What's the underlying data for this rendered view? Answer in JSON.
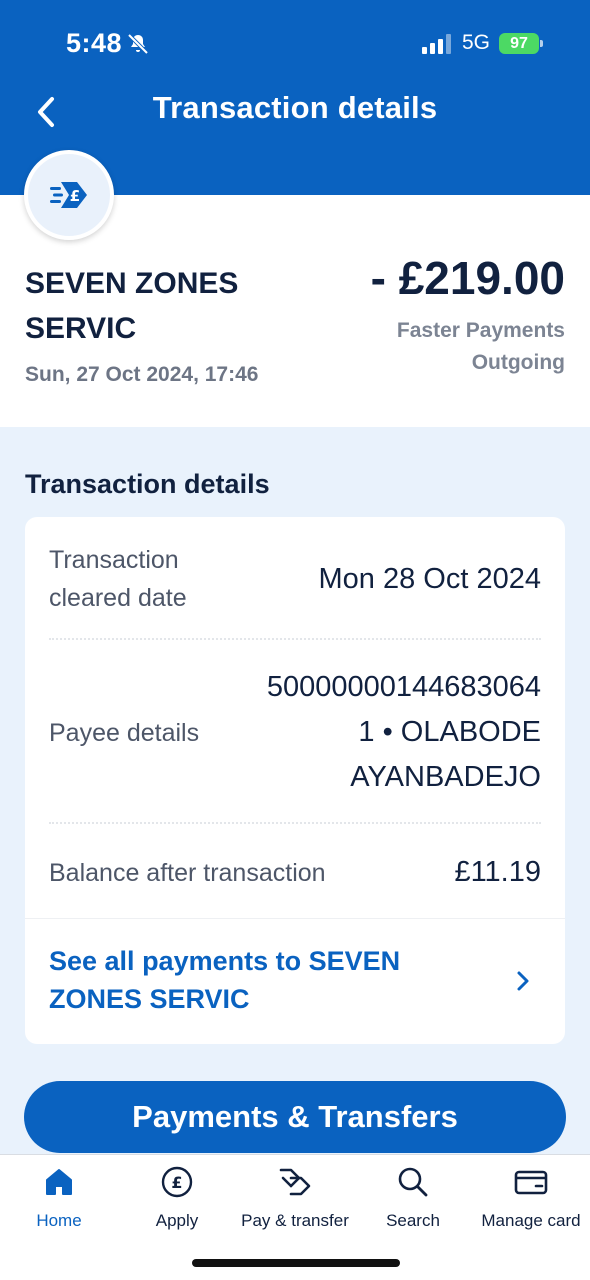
{
  "status_bar": {
    "time": "5:48",
    "network": "5G",
    "battery": "97"
  },
  "header": {
    "title": "Transaction details",
    "back_icon": "chevron-left-icon"
  },
  "transaction": {
    "payee_name": "SEVEN ZONES SERVIC",
    "datetime": "Sun, 27 Oct 2024, 17:46",
    "amount": "- £219.00",
    "method_line1": "Faster Payments",
    "method_line2": "Outgoing",
    "badge_icon": "faster-payment-pound-icon"
  },
  "details": {
    "heading": "Transaction details",
    "rows": [
      {
        "label_line1": "Transaction",
        "label_line2": "cleared date",
        "value": "Mon 28 Oct 2024"
      },
      {
        "label": "Payee details",
        "value_line1": "50000000144683064",
        "value_line2": "1 • OLABODE",
        "value_line3": "AYANBADEJO"
      },
      {
        "label": "Balance after transaction",
        "value": "£11.19"
      }
    ],
    "see_all_line1": "See all payments to SEVEN",
    "see_all_line2": "ZONES SERVIC"
  },
  "primary_action": "Payments & Transfers",
  "bottom_nav": [
    {
      "label": "Home",
      "icon": "home-icon",
      "active": true
    },
    {
      "label": "Apply",
      "icon": "pound-circle-icon",
      "active": false
    },
    {
      "label": "Pay & transfer",
      "icon": "transfer-icon",
      "active": false
    },
    {
      "label": "Search",
      "icon": "search-icon",
      "active": false
    },
    {
      "label": "Manage card",
      "icon": "card-icon",
      "active": false
    }
  ],
  "colors": {
    "brand_blue": "#0a62c0",
    "navy_text": "#11213f",
    "details_background": "#e9f2fc",
    "battery_green": "#4cd964"
  }
}
